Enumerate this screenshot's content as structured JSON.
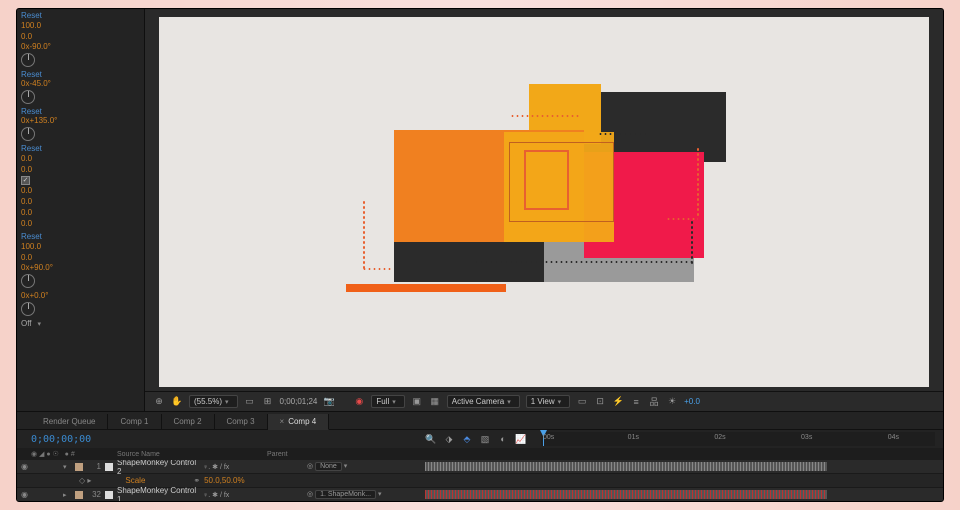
{
  "effects": {
    "groups": [
      {
        "reset": "Reset",
        "lines": [
          "100.0",
          "0.0"
        ],
        "rotation": "0x-90.0°",
        "dial": true
      },
      {
        "reset": "Reset",
        "rotation": "0x-45.0°",
        "dial": true
      },
      {
        "reset": "Reset",
        "rotation": "0x+135.0°",
        "dial": true
      },
      {
        "reset": "Reset",
        "lines": [
          "0.0",
          "0.0"
        ],
        "checkbox": true,
        "more": [
          "0.0",
          "0.0",
          "0.0",
          "0.0"
        ]
      },
      {
        "reset": "Reset",
        "lines": [
          "100.0",
          "0.0"
        ],
        "rotation": "0x+90.0°",
        "dial": true
      },
      {
        "rotation": "0x+0.0°",
        "dial": true
      }
    ],
    "off_label": "Off"
  },
  "preview_toolbar": {
    "zoom": "(55.5%)",
    "timecode": "0;00;01;24",
    "resolution": "Full",
    "camera": "Active Camera",
    "views": "1 View",
    "exposure": "+0.0"
  },
  "tabs": {
    "items": [
      "Render Queue",
      "Comp 1",
      "Comp 2",
      "Comp 3",
      "Comp 4"
    ],
    "active": 4
  },
  "timeline": {
    "timecode": "0;00;00;00",
    "ruler_ticks": [
      "00s",
      "01s",
      "02s",
      "03s",
      "04s"
    ],
    "column_header": {
      "num": "#",
      "source": "Source Name",
      "parent": "Parent"
    },
    "layers": [
      {
        "index": "1",
        "color": "#c0a080",
        "name": "ShapeMonkey Control 2",
        "mode": "♀. ✱ / fx",
        "parent": "None",
        "bar": "default"
      },
      {
        "sub": true,
        "prop": "Scale",
        "value": "50.0,50.0%"
      },
      {
        "index": "32",
        "color": "#c0a080",
        "name": "ShapeMonkey Control 1",
        "mode": "♀. ✱ / fx",
        "parent": "1. ShapeMonk...",
        "bar": "red"
      }
    ]
  },
  "artwork": {}
}
